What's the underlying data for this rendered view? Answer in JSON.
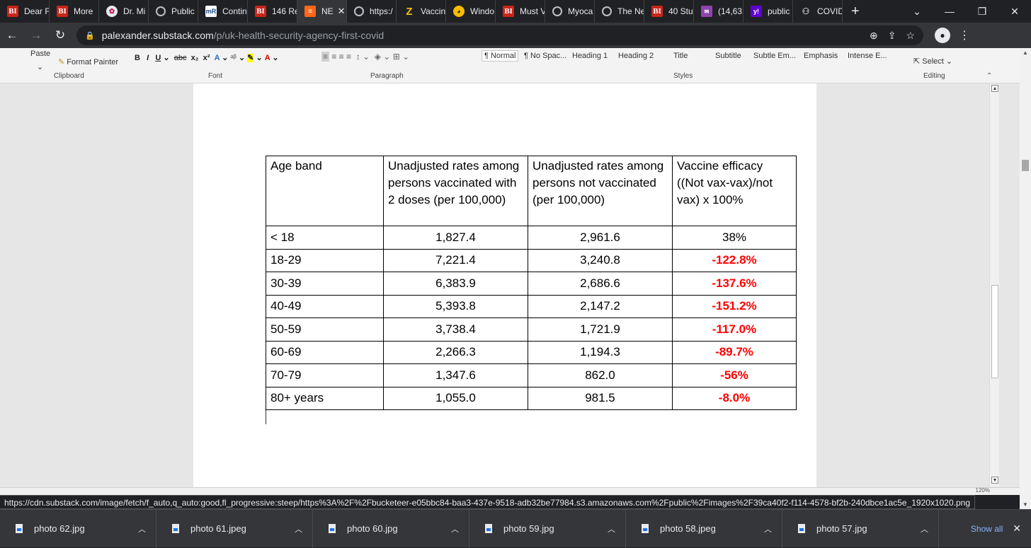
{
  "browser": {
    "tabs": [
      {
        "label": "Dear F",
        "icon": "bi-icon"
      },
      {
        "label": "More",
        "icon": "bi-icon"
      },
      {
        "label": "Dr. Mi",
        "icon": "pinwheel-icon"
      },
      {
        "label": "Public",
        "icon": "globe-icon"
      },
      {
        "label": "Contin",
        "icon": "mr-icon"
      },
      {
        "label": "146 Re",
        "icon": "bi-icon"
      },
      {
        "label": "NE",
        "icon": "substack-icon",
        "active": true
      },
      {
        "label": "https:/",
        "icon": "globe-icon"
      },
      {
        "label": "Vaccin",
        "icon": "z-icon"
      },
      {
        "label": "Windo",
        "icon": "window-icon"
      },
      {
        "label": "Must V",
        "icon": "bi-icon"
      },
      {
        "label": "Myoca",
        "icon": "globe-icon"
      },
      {
        "label": "The Ne",
        "icon": "globe-icon"
      },
      {
        "label": "40 Stu",
        "icon": "bi-icon"
      },
      {
        "label": "(14,63",
        "icon": "mail-icon"
      },
      {
        "label": "public",
        "icon": "yahoo-icon"
      },
      {
        "label": "COVID",
        "icon": "covid-icon"
      }
    ],
    "url_host": "palexander.substack.com",
    "url_path": "/p/uk-health-security-agency-first-covid",
    "link_status": "https://cdn.substack.com/image/fetch/f_auto,q_auto:good,fl_progressive:steep/https%3A%2F%2Fbucketeer-e05bbc84-baa3-437e-9518-adb32be77984.s3.amazonaws.com%2Fpublic%2Fimages%2F39ca40f2-f114-4578-bf2b-240dbce1ac5e_1920x1020.png"
  },
  "ribbon": {
    "paste": "Paste",
    "format_painter": "Format Painter",
    "groups": {
      "clipboard": "Clipboard",
      "font": "Font",
      "paragraph": "Paragraph",
      "styles": "Styles",
      "editing": "Editing"
    },
    "styles": [
      "¶ Normal",
      "¶ No Spac...",
      "Heading 1",
      "Heading 2",
      "Title",
      "Subtitle",
      "Subtle Em...",
      "Emphasis",
      "Intense E..."
    ],
    "select_label": "Select",
    "zoom": "120%"
  },
  "table": {
    "headers": [
      "Age band",
      "Unadjusted rates among persons vaccinated with 2 doses (per 100,000)",
      "Unadjusted rates among persons not vaccinated (per 100,000)",
      "Vaccine efficacy ((Not vax-vax)/not vax) x 100%"
    ],
    "rows": [
      {
        "age": "< 18",
        "vax": "1,827.4",
        "unvax": "2,961.6",
        "efficacy": "38%",
        "negative": false
      },
      {
        "age": "18-29",
        "vax": "7,221.4",
        "unvax": "3,240.8",
        "efficacy": "-122.8%",
        "negative": true
      },
      {
        "age": "30-39",
        "vax": "6,383.9",
        "unvax": "2,686.6",
        "efficacy": "-137.6%",
        "negative": true
      },
      {
        "age": "40-49",
        "vax": "5,393.8",
        "unvax": "2,147.2",
        "efficacy": "-151.2%",
        "negative": true
      },
      {
        "age": "50-59",
        "vax": "3,738.4",
        "unvax": "1,721.9",
        "efficacy": "-117.0%",
        "negative": true
      },
      {
        "age": "60-69",
        "vax": "2,266.3",
        "unvax": "1,194.3",
        "efficacy": "-89.7%",
        "negative": true
      },
      {
        "age": "70-79",
        "vax": "1,347.6",
        "unvax": "862.0",
        "efficacy": "-56%",
        "negative": true
      },
      {
        "age": "80+ years",
        "vax": "1,055.0",
        "unvax": "981.5",
        "efficacy": "-8.0%",
        "negative": true
      }
    ],
    "negative_color": "#ff0000"
  },
  "downloads": {
    "items": [
      "photo 62.jpg",
      "photo 61.jpeg",
      "photo 60.jpg",
      "photo 59.jpg",
      "photo 58.jpeg",
      "photo 57.jpg"
    ],
    "show_all": "Show all"
  }
}
